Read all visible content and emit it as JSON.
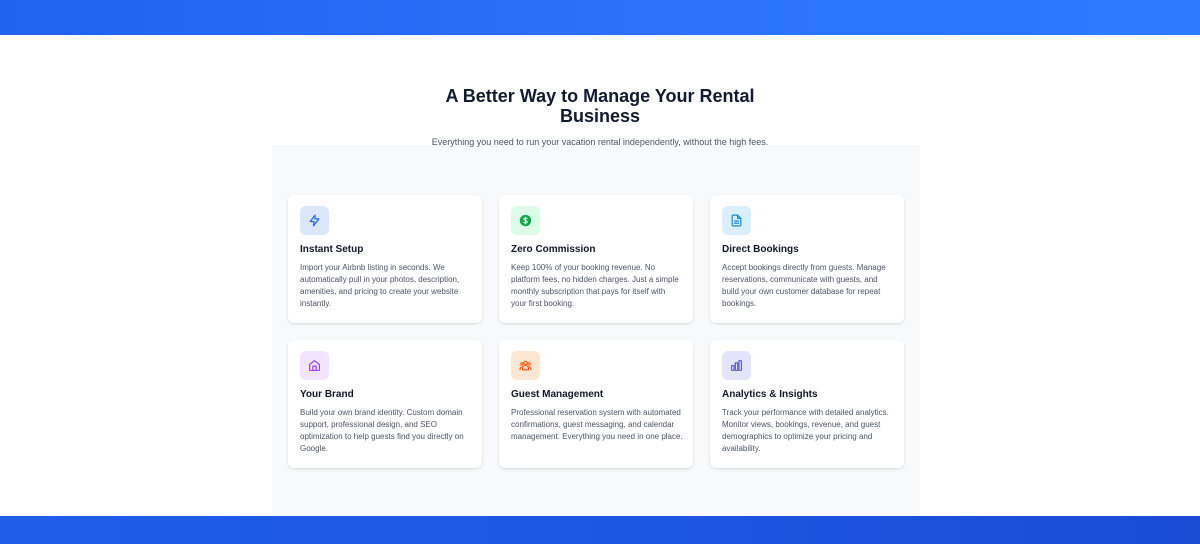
{
  "section": {
    "title": "A Better Way to Manage Your Rental Business",
    "subtitle": "Everything you need to run your vacation rental independently, without the high fees."
  },
  "features": [
    {
      "icon": "lightning-icon",
      "icon_bg": "#dbe7fd",
      "icon_color": "#2563eb",
      "title": "Instant Setup",
      "description": "Import your Airbnb listing in seconds. We automatically pull in your photos, description, amenities, and pricing to create your website instantly."
    },
    {
      "icon": "dollar-icon",
      "icon_bg": "#dcfce7",
      "icon_color": "#16a34a",
      "title": "Zero Commission",
      "description": "Keep 100% of your booking revenue. No platform fees, no hidden charges. Just a simple monthly subscription that pays for itself with your first booking."
    },
    {
      "icon": "document-icon",
      "icon_bg": "#dbeefd",
      "icon_color": "#0284c7",
      "title": "Direct Bookings",
      "description": "Accept bookings directly from guests. Manage reservations, communicate with guests, and build your own customer database for repeat bookings."
    },
    {
      "icon": "home-icon",
      "icon_bg": "#f3e4fd",
      "icon_color": "#9333ea",
      "title": "Your Brand",
      "description": "Build your own brand identity. Custom domain support, professional design, and SEO optimization to help guests find you directly on Google."
    },
    {
      "icon": "users-icon",
      "icon_bg": "#fde7d3",
      "icon_color": "#ea580c",
      "title": "Guest Management",
      "description": "Professional reservation system with automated confirmations, guest messaging, and calendar management. Everything you need in one place."
    },
    {
      "icon": "bar-chart-icon",
      "icon_bg": "#e3e3fb",
      "icon_color": "#4f46e5",
      "title": "Analytics & Insights",
      "description": "Track your performance with detailed analytics. Monitor views, bookings, revenue, and guest demographics to optimize your pricing and availability."
    }
  ]
}
